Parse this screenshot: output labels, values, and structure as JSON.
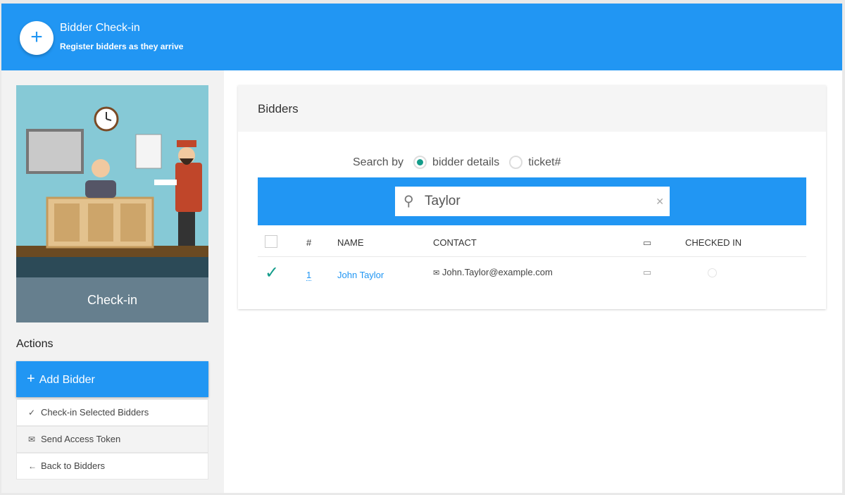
{
  "header": {
    "title": "Bidder Check-in",
    "subtitle": "Register bidders as they arrive",
    "icon": "plus-icon"
  },
  "sidebar": {
    "illustration_label": "Check-in",
    "actions_title": "Actions",
    "add_button": "Add Bidder",
    "actions": [
      {
        "label": "Check-in Selected Bidders",
        "icon": "check-icon"
      },
      {
        "label": "Send Access Token",
        "icon": "mail-icon"
      },
      {
        "label": "Back to Bidders",
        "icon": "arrow-left-icon"
      }
    ]
  },
  "main": {
    "card_title": "Bidders",
    "search_by_label": "Search by",
    "search_options": [
      {
        "label": "bidder details",
        "selected": true
      },
      {
        "label": "ticket#",
        "selected": false
      }
    ],
    "search_value": "Taylor",
    "columns": {
      "num": "#",
      "name": "NAME",
      "contact": "CONTACT",
      "checked_in": "CHECKED IN"
    },
    "rows": [
      {
        "num": "1",
        "name": "John Taylor",
        "email": "John.Taylor@example.com",
        "selected": true
      }
    ]
  },
  "colors": {
    "primary": "#2196F3",
    "teal": "#139c8a"
  }
}
